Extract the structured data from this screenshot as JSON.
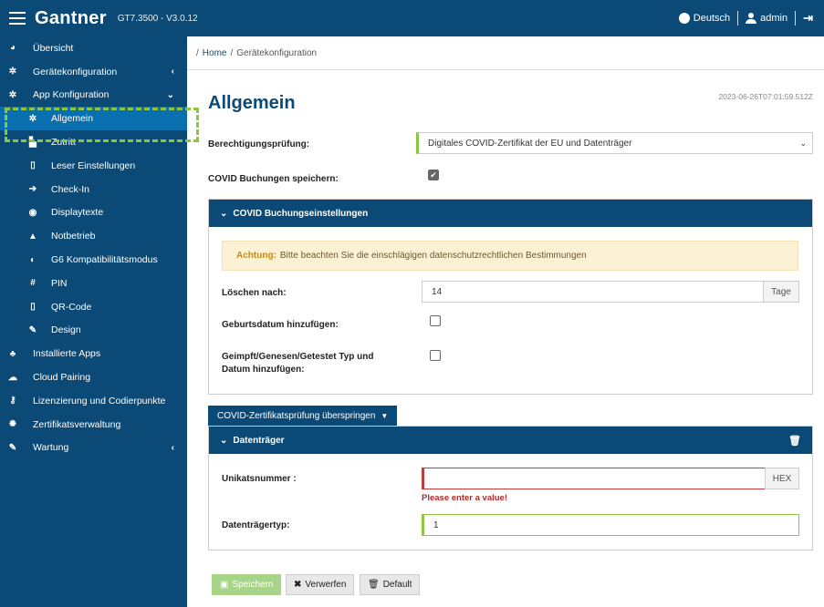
{
  "topbar": {
    "brand": "Gantner",
    "version": "GT7.3500 - V3.0.12",
    "language": "Deutsch",
    "user": "admin",
    "logout_icon": "logout-icon"
  },
  "sidebar": {
    "items": [
      {
        "label": "Übersicht",
        "icon": "pie-chart-icon",
        "glyph": "◕"
      },
      {
        "label": "Gerätekonfiguration",
        "icon": "cog-icon",
        "glyph": "✲",
        "chevron": "‹"
      },
      {
        "label": "App Konfiguration",
        "icon": "cogs-icon",
        "glyph": "✲",
        "chevron": "⌄"
      },
      {
        "label": "Allgemein",
        "icon": "cog-icon",
        "glyph": "✲",
        "active": true
      },
      {
        "label": "Zutritt",
        "icon": "door-icon",
        "glyph": "▙"
      },
      {
        "label": "Leser Einstellungen",
        "icon": "reader-icon",
        "glyph": "▯"
      },
      {
        "label": "Check-In",
        "icon": "sign-in-icon",
        "glyph": "➔"
      },
      {
        "label": "Displaytexte",
        "icon": "globe-icon",
        "glyph": "◉"
      },
      {
        "label": "Notbetrieb",
        "icon": "warning-icon",
        "glyph": "▲"
      },
      {
        "label": "G6 Kompatibilitätsmodus",
        "icon": "shield-icon",
        "glyph": "◐"
      },
      {
        "label": "PIN",
        "icon": "hash-icon",
        "glyph": "#"
      },
      {
        "label": "QR-Code",
        "icon": "qrcode-icon",
        "glyph": "▯"
      },
      {
        "label": "Design",
        "icon": "brush-icon",
        "glyph": "✎"
      },
      {
        "label": "Installierte Apps",
        "icon": "sitemap-icon",
        "glyph": "♣"
      },
      {
        "label": "Cloud Pairing",
        "icon": "cloud-icon",
        "glyph": "☁"
      },
      {
        "label": "Lizenzierung und Codierpunkte",
        "icon": "key-icon",
        "glyph": "⚷"
      },
      {
        "label": "Zertifikatsverwaltung",
        "icon": "certificate-icon",
        "glyph": "✹"
      },
      {
        "label": "Wartung",
        "icon": "wrench-icon",
        "glyph": "✎",
        "chevron": "‹"
      }
    ]
  },
  "breadcrumb": {
    "sep": "/",
    "home": "Home",
    "current": "Gerätekonfiguration"
  },
  "page": {
    "title": "Allgemein",
    "timestamp": "2023-06-26T07:01:59.512Z"
  },
  "form": {
    "permission_label": "Berechtigungsprüfung:",
    "permission_value": "Digitales COVID-Zertifikat der EU und Datenträger",
    "save_bookings_label": "COVID Buchungen speichern:"
  },
  "covid_panel": {
    "title": "COVID Buchungseinstellungen",
    "warning_strong": "Achtung:",
    "warning_text": "Bitte beachten Sie die einschlägigen datenschutzrechtlichen Bestimmungen",
    "delete_after_label": "Löschen nach:",
    "delete_after_value": "14",
    "delete_after_unit": "Tage",
    "birthdate_label": "Geburtsdatum hinzufügen:",
    "vacc_label": "Geimpft/Genesen/Getestet Typ und Datum hinzufügen:"
  },
  "skip_dropdown": {
    "label": "COVID-Zertifikatsprüfung überspringen"
  },
  "media_panel": {
    "title": "Datenträger",
    "unique_label": "Unikatsnummer :",
    "unique_value": "",
    "unique_unit": "HEX",
    "unique_error": "Please enter a value!",
    "type_label": "Datenträgertyp:",
    "type_value": "1"
  },
  "buttons": {
    "save": "Speichern",
    "discard": "Verwerfen",
    "default": "Default"
  },
  "colors": {
    "primary": "#0b4a76",
    "active": "#0a6fae",
    "success": "#8dc63f",
    "error": "#c43b3b"
  }
}
